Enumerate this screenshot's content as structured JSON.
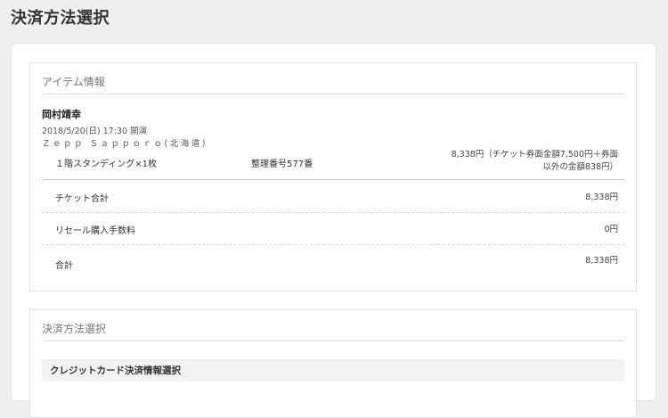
{
  "page": {
    "title": "決済方法選択"
  },
  "items_section": {
    "title": "アイテム情報",
    "artist": "岡村靖幸",
    "datetime": "2018/5/20(日) 17:30 開演",
    "venue": "Ｚｅｐｐ Ｓａｐｐｏｒｏ(北海道)",
    "ticket": {
      "name": "１階スタンディング×1枚",
      "seat": "整理番号577番",
      "price_line1": "8,338円（チケット券面金額7,500円＋券面",
      "price_line2": "以外の金額838円）"
    },
    "rows": [
      {
        "label": "チケット合計",
        "value": "8,338円"
      },
      {
        "label": "リセール購入手数料",
        "value": "0円"
      },
      {
        "label": "合計",
        "value": "8,338円"
      }
    ]
  },
  "payment_section": {
    "title": "決済方法選択",
    "credit_card_label": "クレジットカード決済情報選択"
  }
}
